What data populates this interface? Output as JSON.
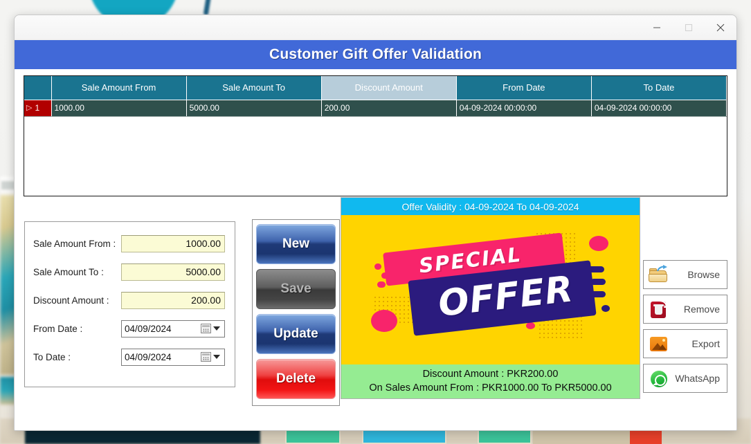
{
  "window": {
    "minimize_label": "Minimize",
    "maximize_label": "Maximize",
    "close_label": "Close",
    "app_title": "Customer Gift Offer Validation",
    "accent_color": "#4169d8"
  },
  "grid": {
    "row_header_label": "",
    "columns": [
      "Sale Amount From",
      "Sale Amount To",
      "Discount Amount",
      "From Date",
      "To Date"
    ],
    "selected_column": "Discount Amount",
    "header_color": "#1a7490",
    "selected_header_color": "#b7cdda",
    "row_color": "#2f504c",
    "row_indicator_color": "#b10000",
    "rows": [
      {
        "number": "1",
        "marker": "▷",
        "cells": [
          "1000.00",
          "5000.00",
          "200.00",
          "04-09-2024 00:00:00",
          "04-09-2024 00:00:00"
        ]
      }
    ]
  },
  "form": {
    "fields": [
      {
        "label": "Sale Amount From :",
        "value": "1000.00",
        "type": "text"
      },
      {
        "label": "Sale Amount To :",
        "value": "5000.00",
        "type": "text"
      },
      {
        "label": "Discount Amount :",
        "value": "200.00",
        "type": "text"
      },
      {
        "label": "From Date :",
        "value": "04/09/2024",
        "type": "date"
      },
      {
        "label": "To Date :",
        "value": "04/09/2024",
        "type": "date"
      }
    ]
  },
  "action_buttons": {
    "new_label": "New",
    "save_label": "Save",
    "save_enabled": false,
    "update_label": "Update",
    "delete_label": "Delete"
  },
  "offer": {
    "validity_text": "Offer Validity : 04-09-2024 To 04-09-2024",
    "validity_bg": "#10b9ef",
    "art_bg": "#ffd400",
    "art_word_1": "SPECIAL",
    "art_word_2": "OFFER",
    "footer_line_1": "Discount Amount : PKR200.00",
    "footer_line_2": "On Sales Amount From : PKR1000.00 To PKR5000.00",
    "footer_bg": "#95ec92"
  },
  "image_actions": [
    {
      "label": "Browse",
      "icon": "folder-open-icon"
    },
    {
      "label": "Remove",
      "icon": "trash-delete-icon"
    },
    {
      "label": "Export",
      "icon": "picture-export-icon"
    },
    {
      "label": "WhatsApp",
      "icon": "whatsapp-icon"
    }
  ]
}
